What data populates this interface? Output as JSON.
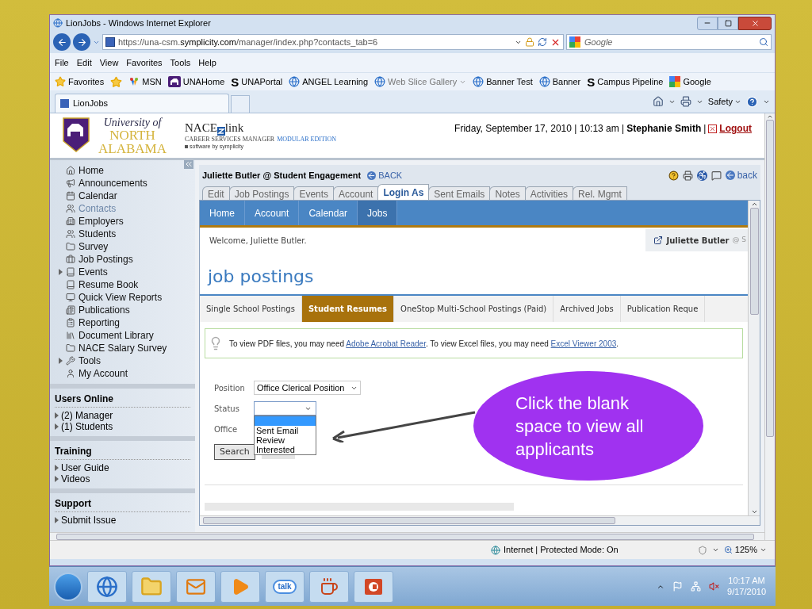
{
  "window": {
    "title": "LionJobs - Windows Internet Explorer"
  },
  "address_bar": {
    "url_scheme": "https://una-csm.",
    "url_domain": "symplicity.com",
    "url_path": "/manager/index.php?contacts_tab=6",
    "search_placeholder": "Google"
  },
  "menu": [
    "File",
    "Edit",
    "View",
    "Favorites",
    "Tools",
    "Help"
  ],
  "favorites_bar": {
    "label": "Favorites",
    "items": [
      {
        "kind": "star-add",
        "disabled": false
      },
      {
        "kind": "msn",
        "label": "MSN",
        "dropdown": false,
        "disabled": false
      },
      {
        "kind": "una",
        "label": "UNAHome",
        "dropdown": false,
        "disabled": false
      },
      {
        "kind": "s",
        "glyph": "S",
        "label": "UNAPortal",
        "dropdown": false,
        "disabled": false
      },
      {
        "kind": "ie",
        "label": "ANGEL Learning",
        "dropdown": false,
        "disabled": false
      },
      {
        "kind": "ie",
        "label": "Web Slice Gallery",
        "dropdown": true,
        "disabled": true
      },
      {
        "kind": "ie",
        "label": "Banner Test",
        "dropdown": false,
        "disabled": false
      },
      {
        "kind": "ie",
        "label": "Banner",
        "dropdown": false,
        "disabled": false
      },
      {
        "kind": "s",
        "glyph": "S",
        "label": "Campus Pipeline",
        "dropdown": false,
        "disabled": false
      },
      {
        "kind": "google",
        "label": "Google",
        "dropdown": false,
        "disabled": false
      }
    ]
  },
  "browser_tabs": [
    {
      "label": "LionJobs",
      "selected": true
    }
  ],
  "command_bar": {
    "safety": "Safety"
  },
  "header": {
    "university": [
      "University of",
      "NORTH",
      "ALABAMA"
    ],
    "product": "NACE",
    "product_suffix": "link",
    "subtitle": "CAREER SERVICES MANAGER",
    "edition": "MODULAR EDITION",
    "vendor": "software by symplicity",
    "date_line": "Friday, September 17, 2010 | 10:13 am |",
    "user": "Stephanie Smith",
    "separator": "|",
    "logout": "Logout"
  },
  "sidebar": {
    "nav": [
      {
        "label": "Home",
        "kind": "home",
        "expandable": false,
        "selected": false
      },
      {
        "label": "Announcements",
        "kind": "megaphone",
        "expandable": false,
        "selected": false
      },
      {
        "label": "Calendar",
        "kind": "calendar",
        "expandable": false,
        "selected": false
      },
      {
        "label": "Contacts",
        "kind": "people",
        "expandable": false,
        "selected": true
      },
      {
        "label": "Employers",
        "kind": "building",
        "expandable": false,
        "selected": false
      },
      {
        "label": "Students",
        "kind": "people",
        "expandable": false,
        "selected": false
      },
      {
        "label": "Survey",
        "kind": "folder",
        "expandable": false,
        "selected": false
      },
      {
        "label": "Job Postings",
        "kind": "briefcase",
        "expandable": false,
        "selected": false
      },
      {
        "label": "Events",
        "kind": "book",
        "expandable": true,
        "selected": false
      },
      {
        "label": "Resume Book",
        "kind": "book",
        "expandable": false,
        "selected": false
      },
      {
        "label": "Quick View Reports",
        "kind": "monitor",
        "expandable": false,
        "selected": false
      },
      {
        "label": "Publications",
        "kind": "newspaper",
        "expandable": false,
        "selected": false
      },
      {
        "label": "Reporting",
        "kind": "clipboard",
        "expandable": false,
        "selected": false
      },
      {
        "label": "Document Library",
        "kind": "library",
        "expandable": false,
        "selected": false
      },
      {
        "label": "NACE Salary Survey",
        "kind": "folder",
        "expandable": false,
        "selected": false
      },
      {
        "label": "Tools",
        "kind": "wrench",
        "expandable": true,
        "selected": false
      },
      {
        "label": "My Account",
        "kind": "user",
        "expandable": false,
        "selected": false
      }
    ],
    "panels": [
      {
        "title": "Users Online",
        "items": [
          "(2) Manager",
          "(1) Students"
        ]
      },
      {
        "title": "Training",
        "items": [
          "User Guide",
          "Videos"
        ]
      },
      {
        "title": "Support",
        "items": [
          "Submit Issue"
        ]
      }
    ]
  },
  "contact": {
    "title": "Juliette Butler @ Student Engagement",
    "back_link": "BACK",
    "back_right": "back",
    "tabs": [
      {
        "label": "Edit",
        "selected": false
      },
      {
        "label": "Job Postings",
        "selected": false
      },
      {
        "label": "Events",
        "selected": false
      },
      {
        "label": "Account",
        "selected": false
      },
      {
        "label": "Login As",
        "selected": true
      },
      {
        "label": "Sent Emails",
        "selected": false
      },
      {
        "label": "Notes",
        "selected": false
      },
      {
        "label": "Activities",
        "selected": false
      },
      {
        "label": "Rel. Mgmt",
        "selected": false
      }
    ]
  },
  "portal": {
    "nav": [
      {
        "label": "Home",
        "selected": false
      },
      {
        "label": "Account",
        "selected": false
      },
      {
        "label": "Calendar",
        "selected": false
      },
      {
        "label": "Jobs",
        "selected": true
      }
    ],
    "welcome": "Welcome, Juliette Butler.",
    "user_chip": "Juliette Butler",
    "user_chip_suffix": "@ S",
    "heading": "job postings",
    "subtabs": [
      {
        "label": "Single School Postings",
        "selected": false
      },
      {
        "label": "Student Resumes",
        "selected": true
      },
      {
        "label": "OneStop Multi-School Postings (Paid)",
        "selected": false
      },
      {
        "label": "Archived Jobs",
        "selected": false
      },
      {
        "label": "Publication Reque",
        "selected": false
      }
    ],
    "notice": [
      {
        "kind": "text",
        "text": "To view PDF files, you may need "
      },
      {
        "kind": "link",
        "text": "Adobe Acrobat Reader"
      },
      {
        "kind": "text",
        "text": ". To view Excel files, you may need "
      },
      {
        "kind": "link",
        "text": "Excel Viewer 2003"
      },
      {
        "kind": "text",
        "text": "."
      }
    ],
    "form": {
      "position_label": "Position",
      "position_value": "Office Clerical Position",
      "status_label": "Status",
      "status_expanded": true,
      "status_options": [
        {
          "selected": true
        },
        {
          "label": "Sent Email",
          "selected": false
        },
        {
          "label": "Review",
          "selected": false
        },
        {
          "label": "Interested",
          "selected": false
        }
      ],
      "office_label": "Office",
      "search": "Search"
    }
  },
  "callout": {
    "text": "Click the blank space to view all applicants"
  },
  "status_bar": {
    "zone": "Internet | Protected Mode: On",
    "zoom": "125%"
  },
  "taskbar": {
    "apps": [
      {
        "kind": "ie"
      },
      {
        "kind": "folder"
      },
      {
        "kind": "outlook"
      },
      {
        "kind": "media"
      },
      {
        "kind": "talk",
        "label": "talk"
      },
      {
        "kind": "java"
      },
      {
        "kind": "powerpoint"
      }
    ],
    "time": "10:17 AM",
    "date": "9/17/2010"
  }
}
